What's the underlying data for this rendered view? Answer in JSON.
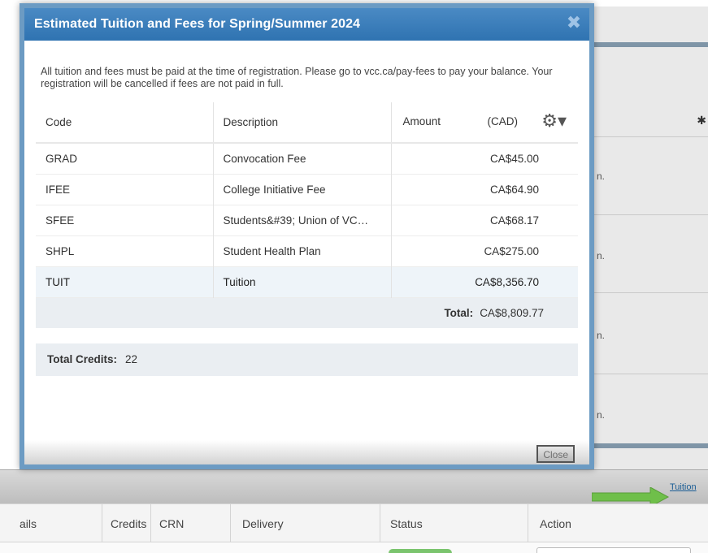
{
  "background": {
    "right_panel_row_texts": [
      "n.",
      "n.",
      "n.",
      "n."
    ],
    "tuition_link": "Tuition",
    "table_headers": [
      "ails",
      "Credits",
      "CRN",
      "Delivery",
      "Status",
      "Action"
    ],
    "status_color": "#7bc46e"
  },
  "modal": {
    "title": "Estimated Tuition and Fees for Spring/Summer 2024",
    "close_icon": "close-x-icon",
    "notice": "All tuition and fees must be paid at the time of registration. Please go to vcc.ca/pay-fees to pay your balance. Your registration will be cancelled if fees are not paid in full.",
    "table": {
      "headers": {
        "code": "Code",
        "description": "Description",
        "amount": "Amount",
        "currency": "(CAD)",
        "settings_icon": "gear-icon"
      },
      "rows": [
        {
          "code": "GRAD",
          "description": "Convocation Fee",
          "amount": "CA$45.00"
        },
        {
          "code": "IFEE",
          "description": "College Initiative Fee",
          "amount": "CA$64.90"
        },
        {
          "code": "SFEE",
          "description": "Students&#39; Union of VC…",
          "amount": "CA$68.17"
        },
        {
          "code": "SHPL",
          "description": "Student Health Plan",
          "amount": "CA$275.00"
        },
        {
          "code": "TUIT",
          "description": "Tuition",
          "amount": "CA$8,356.70"
        }
      ],
      "total_label": "Total:",
      "total_value": "CA$8,809.77"
    },
    "credits_label": "Total Credits:",
    "credits_value": "22",
    "close_button": "Close",
    "accent_color": "#2f73b1"
  }
}
